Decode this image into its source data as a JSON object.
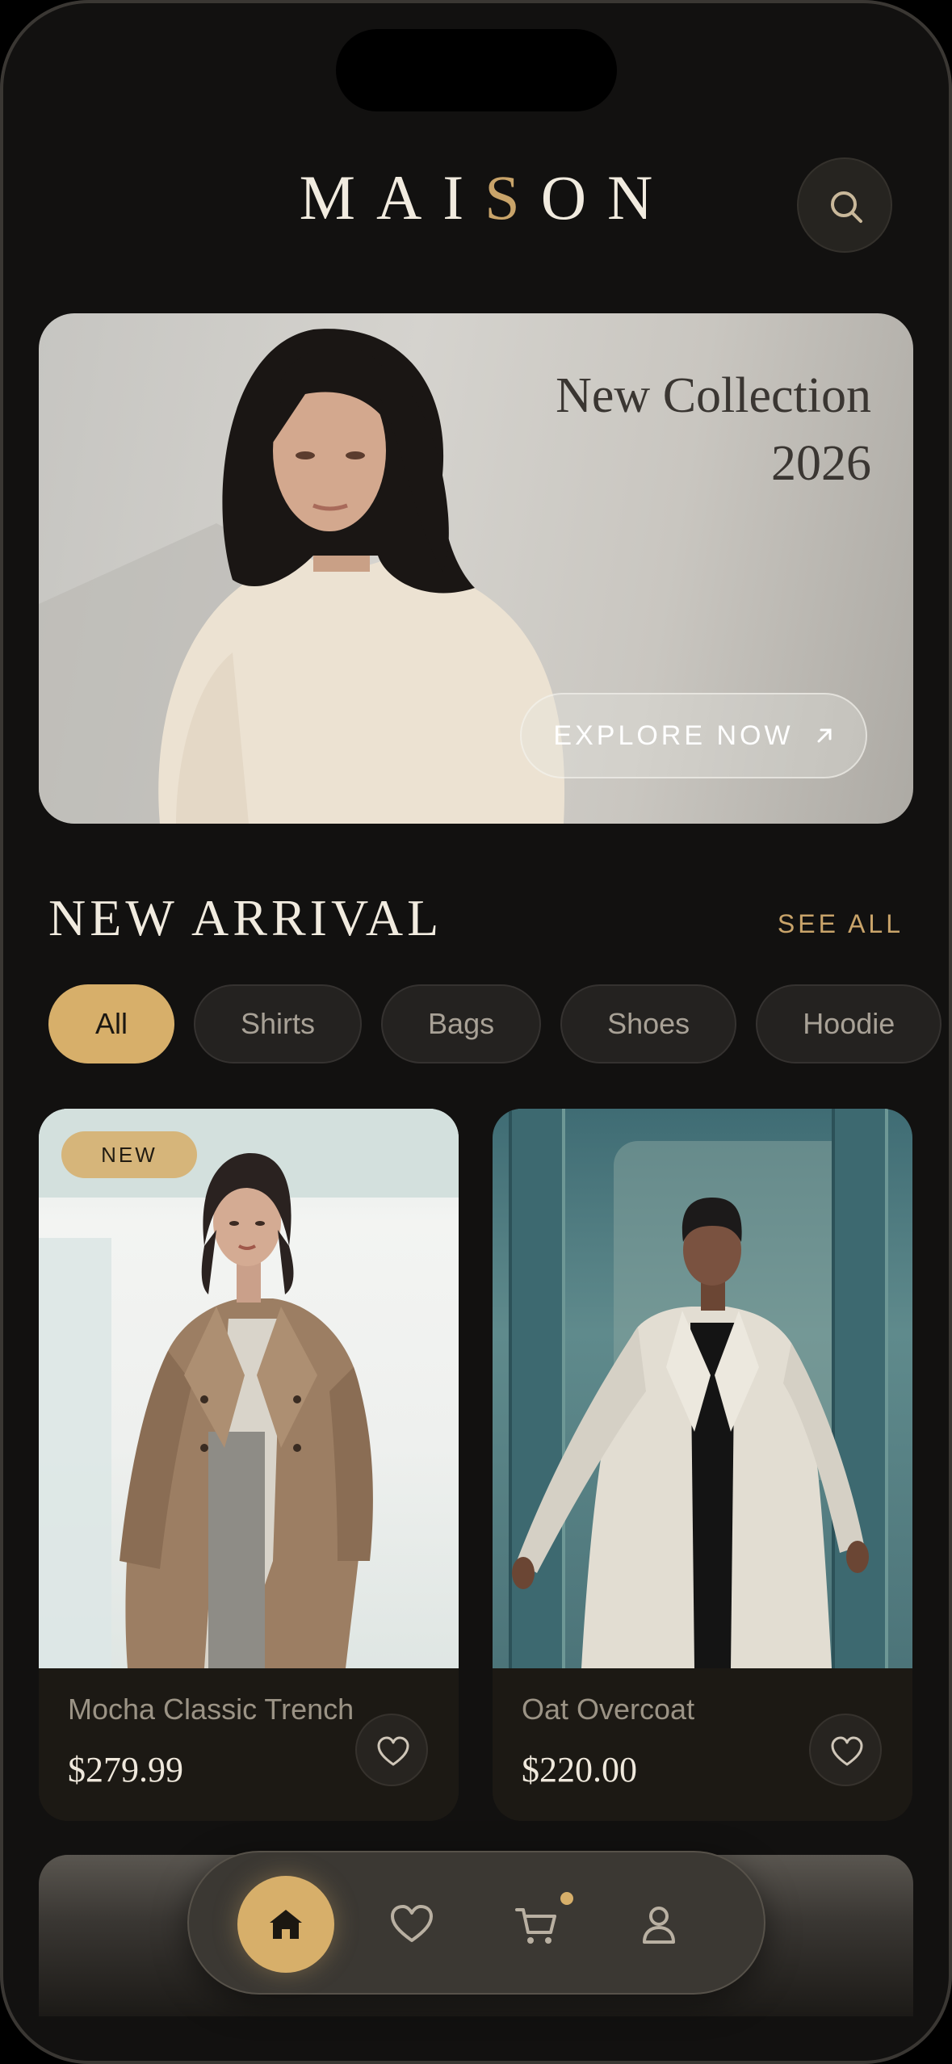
{
  "brand": {
    "logo_pre": "MAI",
    "logo_accent": "S",
    "logo_post": "ON",
    "accent_color": "#c9a46a"
  },
  "header": {
    "search_icon": "search-icon"
  },
  "hero": {
    "title_line1": "New Collection",
    "title_line2": "2026",
    "cta_label": "EXPLORE NOW",
    "cta_icon": "arrow-up-right-icon"
  },
  "section": {
    "title": "NEW ARRIVAL",
    "see_all": "SEE ALL"
  },
  "categories": {
    "selected": "All",
    "items": [
      "All",
      "Shirts",
      "Bags",
      "Shoes",
      "Hoodie"
    ]
  },
  "products": [
    {
      "badge": "NEW",
      "name": "Mocha Classic Trench",
      "price": "$279.99",
      "fav_icon": "heart-icon"
    },
    {
      "badge": "",
      "name": "Oat Overcoat",
      "price": "$220.00",
      "fav_icon": "heart-icon"
    }
  ],
  "tabbar": {
    "active": "home",
    "items": [
      "home-icon",
      "heart-icon",
      "cart-icon",
      "profile-icon"
    ],
    "cart_has_items": true
  }
}
